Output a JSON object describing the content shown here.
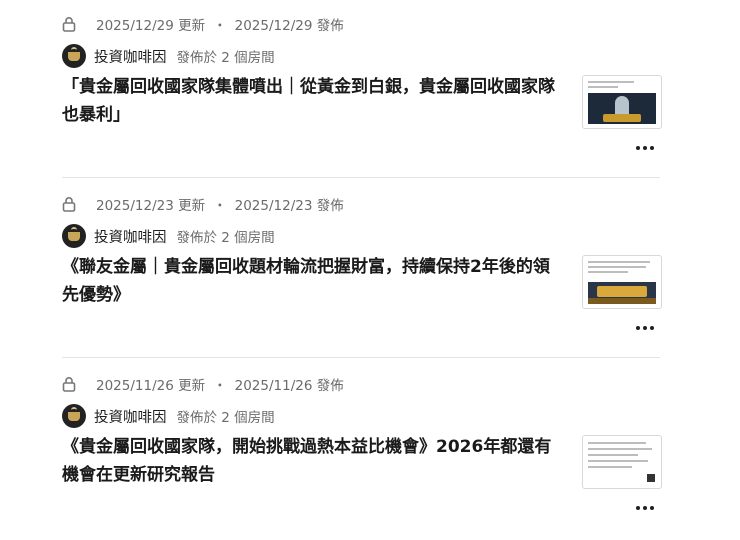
{
  "posts": [
    {
      "updated": "2025/12/29 更新",
      "published": "2025/12/29 發佈",
      "separator": "・",
      "author": "投資咖啡因",
      "posted_in": "發佈於 2 個房間",
      "title": "「貴金屬回收國家隊集體噴出｜從黃金到白銀，貴金屬回收國家隊也暴利」"
    },
    {
      "updated": "2025/12/23 更新",
      "published": "2025/12/23 發佈",
      "separator": "・",
      "author": "投資咖啡因",
      "posted_in": "發佈於 2 個房間",
      "title": "《聯友金屬｜貴金屬回收題材輪流把握財富，持續保持2年後的領先優勢》"
    },
    {
      "updated": "2025/11/26 更新",
      "published": "2025/11/26 發佈",
      "separator": "・",
      "author": "投資咖啡因",
      "posted_in": "發佈於 2 個房間",
      "title": "《貴金屬回收國家隊，開始挑戰過熱本益比機會》2026年都還有機會在更新研究報告"
    }
  ],
  "icons": {
    "lock": "lock-icon",
    "more": "more-options-icon"
  },
  "colors": {
    "meta_text": "#6b6b6b",
    "title_text": "#1a1a1a",
    "divider": "#e4e4e4"
  }
}
